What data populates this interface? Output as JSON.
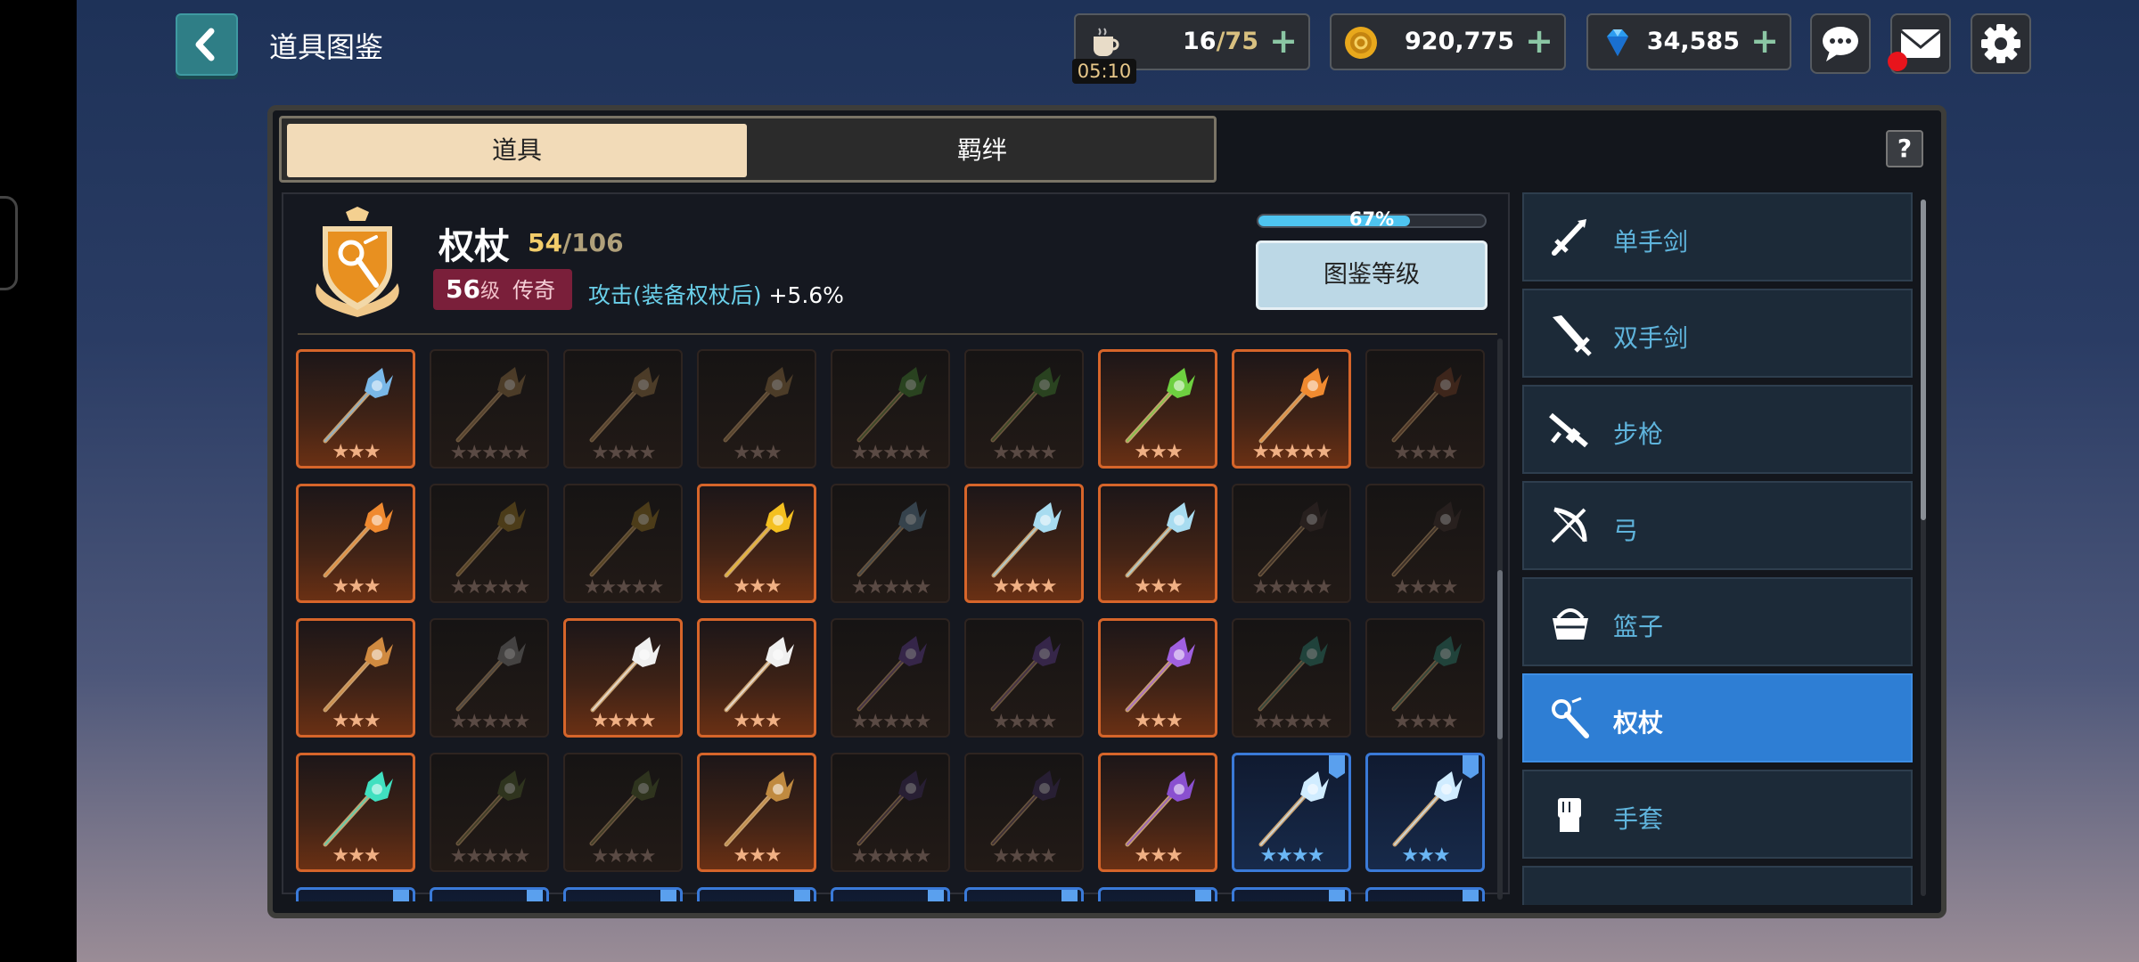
{
  "header": {
    "title": "道具图鉴",
    "stamina": {
      "current": "16",
      "max": "/75",
      "timer": "05:10"
    },
    "gold": "920,775",
    "gems": "34,585",
    "plus": "+"
  },
  "tabs": {
    "items": "道具",
    "bonds": "羁绊"
  },
  "help_label": "?",
  "category_info": {
    "name": "权杖",
    "collected": "54",
    "total": "/106",
    "level_number": "56",
    "level_unit": "级",
    "rarity": "传奇",
    "bonus_label": "攻击(装备权杖后)",
    "bonus_value": "+5.6%",
    "progress_text": "67%",
    "progress_value": 0.67,
    "level_button": "图鉴等级"
  },
  "grid": [
    {
      "state": "own",
      "stars": "★★★",
      "color": "#7ab8e8"
    },
    {
      "state": "lock",
      "stars": "★★★★★",
      "color": "#8a6a40"
    },
    {
      "state": "lock",
      "stars": "★★★★",
      "color": "#8a6a40"
    },
    {
      "state": "lock",
      "stars": "★★★",
      "color": "#8a6a40"
    },
    {
      "state": "lock",
      "stars": "★★★★★",
      "color": "#3e7a2e"
    },
    {
      "state": "lock",
      "stars": "★★★★",
      "color": "#3e7a2e"
    },
    {
      "state": "own",
      "stars": "★★★",
      "color": "#6ed040"
    },
    {
      "state": "own",
      "stars": "★★★★★",
      "color": "#f08a30"
    },
    {
      "state": "lock",
      "stars": "★★★★",
      "color": "#6a3a24"
    },
    {
      "state": "own",
      "stars": "★★★",
      "color": "#f08a30"
    },
    {
      "state": "lock",
      "stars": "★★★★★",
      "color": "#8a6a20"
    },
    {
      "state": "lock",
      "stars": "★★★★★",
      "color": "#8a6a20"
    },
    {
      "state": "own",
      "stars": "★★★",
      "color": "#f4c020"
    },
    {
      "state": "lock",
      "stars": "★★★★★",
      "color": "#5a7a90"
    },
    {
      "state": "own",
      "stars": "★★★★",
      "color": "#a8dcf0"
    },
    {
      "state": "own",
      "stars": "★★★",
      "color": "#a8dcf0"
    },
    {
      "state": "lock",
      "stars": "★★★★★",
      "color": "#3a2e2a"
    },
    {
      "state": "lock",
      "stars": "★★★★",
      "color": "#3a2e2a"
    },
    {
      "state": "own",
      "stars": "★★★",
      "color": "#d08a40"
    },
    {
      "state": "lock",
      "stars": "★★★★★",
      "color": "#7a7a7a"
    },
    {
      "state": "own",
      "stars": "★★★★",
      "color": "#f0f0f0"
    },
    {
      "state": "own",
      "stars": "★★★",
      "color": "#f0f0f0"
    },
    {
      "state": "lock",
      "stars": "★★★★★",
      "color": "#5a3a8a"
    },
    {
      "state": "lock",
      "stars": "★★★★",
      "color": "#5a3a8a"
    },
    {
      "state": "own",
      "stars": "★★★",
      "color": "#a060e0"
    },
    {
      "state": "lock",
      "stars": "★★★★★",
      "color": "#2a7a6a"
    },
    {
      "state": "lock",
      "stars": "★★★★",
      "color": "#2a7a6a"
    },
    {
      "state": "own",
      "stars": "★★★",
      "color": "#40e0c0"
    },
    {
      "state": "lock",
      "stars": "★★★★★",
      "color": "#4a5a2a"
    },
    {
      "state": "lock",
      "stars": "★★★★",
      "color": "#4a5a2a"
    },
    {
      "state": "own",
      "stars": "★★★",
      "color": "#c08a40"
    },
    {
      "state": "lock",
      "stars": "★★★★★",
      "color": "#3a2a5a"
    },
    {
      "state": "lock",
      "stars": "★★★★",
      "color": "#3a2a5a"
    },
    {
      "state": "own",
      "stars": "★★★",
      "color": "#8a50d0"
    },
    {
      "state": "blue",
      "stars": "★★★★",
      "color": "#d0ecff"
    },
    {
      "state": "blue",
      "stars": "★★★",
      "color": "#d0ecff"
    },
    {
      "state": "blue",
      "stars": "",
      "color": "#6a90c0"
    },
    {
      "state": "blue",
      "stars": "",
      "color": "#6a90c0"
    },
    {
      "state": "blue",
      "stars": "",
      "color": "#6a90c0"
    },
    {
      "state": "blue",
      "stars": "",
      "color": "#6a90c0"
    },
    {
      "state": "blue",
      "stars": "",
      "color": "#6a90c0"
    },
    {
      "state": "blue",
      "stars": "",
      "color": "#6a90c0"
    },
    {
      "state": "blue",
      "stars": "",
      "color": "#6a90c0"
    },
    {
      "state": "blue",
      "stars": "",
      "color": "#6a90c0"
    },
    {
      "state": "blue",
      "stars": "",
      "color": "#6a90c0"
    }
  ],
  "categories": [
    {
      "label": "单手剑",
      "icon": "sword-icon",
      "selected": false
    },
    {
      "label": "双手剑",
      "icon": "greatsword-icon",
      "selected": false
    },
    {
      "label": "步枪",
      "icon": "rifle-icon",
      "selected": false
    },
    {
      "label": "弓",
      "icon": "bow-icon",
      "selected": false
    },
    {
      "label": "篮子",
      "icon": "basket-icon",
      "selected": false
    },
    {
      "label": "权杖",
      "icon": "scepter-icon",
      "selected": true
    },
    {
      "label": "手套",
      "icon": "gauntlet-icon",
      "selected": false
    },
    {
      "label": "",
      "icon": "more-icon",
      "selected": false
    }
  ]
}
